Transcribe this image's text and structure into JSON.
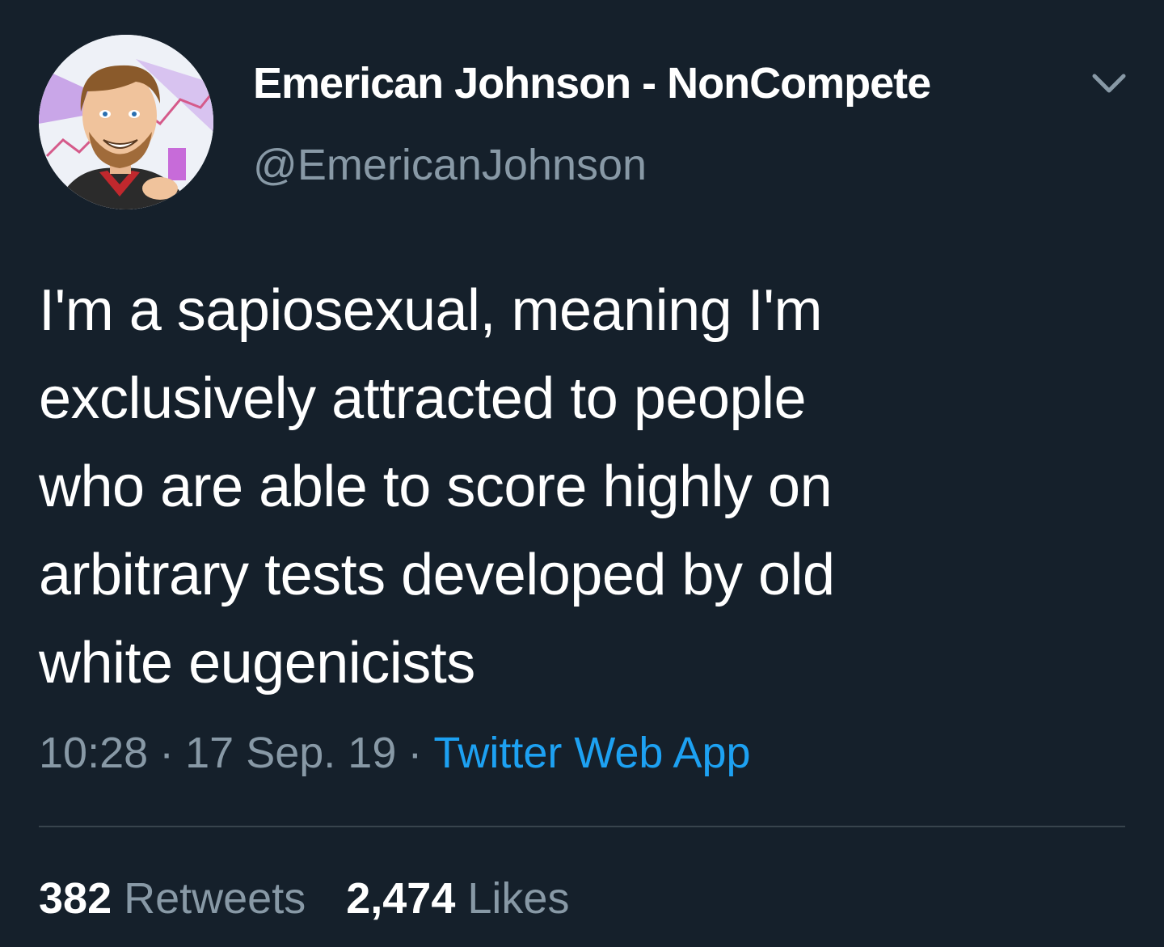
{
  "tweet": {
    "author": {
      "display_name": "Emerican Johnson - NonCompete",
      "handle": "@EmericanJohnson",
      "avatar_icon": "cartoon-portrait-avatar"
    },
    "text_lines": [
      "I'm a sapiosexual, meaning I'm",
      "exclusively attracted to people",
      "who are able to score highly on",
      "arbitrary tests developed by old",
      "white eugenicists"
    ],
    "time": "10:28",
    "separator": "·",
    "date": "17 Sep. 19",
    "source": "Twitter Web App",
    "retweets": {
      "count": "382",
      "label": "Retweets"
    },
    "likes": {
      "count": "2,474",
      "label": "Likes"
    },
    "menu_icon": "chevron-down-icon"
  },
  "colors": {
    "background": "#15202b",
    "text_primary": "#ffffff",
    "text_secondary": "#8899a6",
    "link": "#1da1f2",
    "divider": "#38444d"
  }
}
